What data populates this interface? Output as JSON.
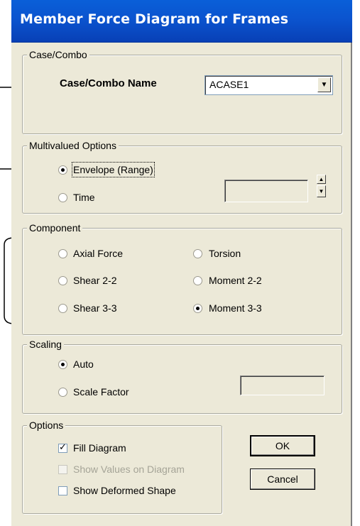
{
  "window": {
    "title": "Member Force Diagram for Frames"
  },
  "case_combo": {
    "group_label": "Case/Combo",
    "name_label": "Case/Combo Name",
    "selected": "ACASE1"
  },
  "multivalued": {
    "group_label": "Multivalued Options",
    "envelope_label": "Envelope (Range)",
    "time_label": "Time",
    "selected": "Envelope (Range)",
    "time_value": ""
  },
  "component": {
    "group_label": "Component",
    "options": [
      "Axial Force",
      "Torsion",
      "Shear 2-2",
      "Moment 2-2",
      "Shear 3-3",
      "Moment 3-3"
    ],
    "selected": "Moment 3-3"
  },
  "scaling": {
    "group_label": "Scaling",
    "auto_label": "Auto",
    "scale_factor_label": "Scale Factor",
    "selected": "Auto",
    "scale_factor_value": ""
  },
  "options": {
    "group_label": "Options",
    "fill_diagram_label": "Fill Diagram",
    "fill_diagram_checked": true,
    "show_values_label": "Show Values on Diagram",
    "show_values_checked": false,
    "show_values_enabled": false,
    "show_deformed_label": "Show Deformed Shape",
    "show_deformed_checked": false
  },
  "buttons": {
    "ok": "OK",
    "cancel": "Cancel"
  }
}
